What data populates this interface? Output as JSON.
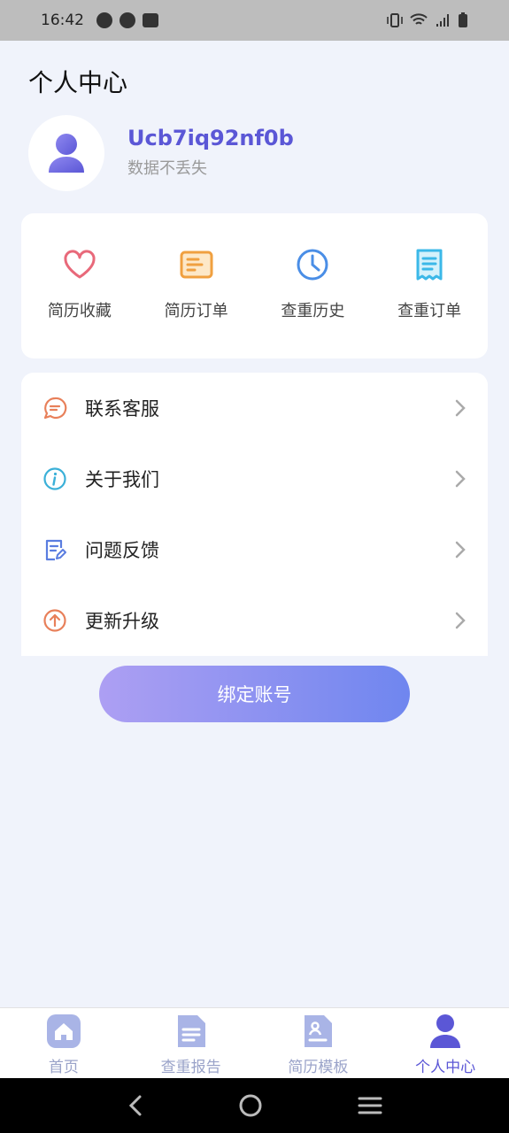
{
  "status_bar": {
    "time": "16:42"
  },
  "header": {
    "title": "个人中心"
  },
  "user": {
    "name": "Ucb7iq92nf0b",
    "subtitle": "数据不丢失"
  },
  "shortcuts": [
    {
      "label": "简历收藏",
      "icon": "heart-icon",
      "color": "#e8697a"
    },
    {
      "label": "简历订单",
      "icon": "order-icon",
      "color": "#f0a040"
    },
    {
      "label": "查重历史",
      "icon": "clock-icon",
      "color": "#4a8ee6"
    },
    {
      "label": "查重订单",
      "icon": "document-icon",
      "color": "#3bb8e8"
    }
  ],
  "menu": [
    {
      "label": "联系客服",
      "icon": "chat-icon",
      "color": "#e8805a"
    },
    {
      "label": "关于我们",
      "icon": "info-icon",
      "color": "#3bb0d8"
    },
    {
      "label": "问题反馈",
      "icon": "feedback-icon",
      "color": "#5a7de0"
    },
    {
      "label": "更新升级",
      "icon": "upgrade-icon",
      "color": "#e8805a"
    }
  ],
  "bind_button": {
    "label": "绑定账号"
  },
  "tabs": [
    {
      "label": "首页",
      "icon": "home-icon"
    },
    {
      "label": "查重报告",
      "icon": "report-icon"
    },
    {
      "label": "简历模板",
      "icon": "template-icon"
    },
    {
      "label": "个人中心",
      "icon": "person-icon",
      "active": true
    }
  ],
  "colors": {
    "accent": "#5b57d6",
    "tab_inactive": "#9aa3c9",
    "background": "#f0f3fb"
  }
}
